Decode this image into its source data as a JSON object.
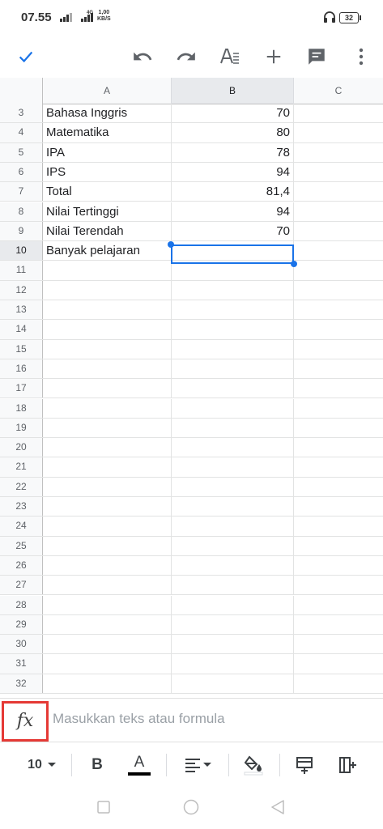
{
  "status_bar": {
    "time": "07.55",
    "network": "4G",
    "speed_value": "1,00",
    "speed_unit": "KB/S",
    "battery": "32"
  },
  "toolbar": {
    "done_icon": "check-icon",
    "undo_icon": "undo-icon",
    "redo_icon": "redo-icon",
    "text_format_icon": "text-format-icon",
    "insert_icon": "plus-icon",
    "comment_icon": "comment-icon",
    "more_icon": "more-vert-icon"
  },
  "grid": {
    "columns": [
      "A",
      "B",
      "C"
    ],
    "rows": [
      {
        "num": "3",
        "a": "Bahasa Inggris",
        "b": "70"
      },
      {
        "num": "4",
        "a": "Matematika",
        "b": "80"
      },
      {
        "num": "5",
        "a": "IPA",
        "b": "78"
      },
      {
        "num": "6",
        "a": "IPS",
        "b": "94"
      },
      {
        "num": "7",
        "a": "Total",
        "b": "81,4"
      },
      {
        "num": "8",
        "a": "Nilai Tertinggi",
        "b": "94"
      },
      {
        "num": "9",
        "a": "Nilai Terendah",
        "b": "70"
      },
      {
        "num": "10",
        "a": "Banyak pelajaran",
        "b": ""
      },
      {
        "num": "11",
        "a": "",
        "b": ""
      },
      {
        "num": "12",
        "a": "",
        "b": ""
      },
      {
        "num": "13",
        "a": "",
        "b": ""
      },
      {
        "num": "14",
        "a": "",
        "b": ""
      },
      {
        "num": "15",
        "a": "",
        "b": ""
      },
      {
        "num": "16",
        "a": "",
        "b": ""
      },
      {
        "num": "17",
        "a": "",
        "b": ""
      },
      {
        "num": "18",
        "a": "",
        "b": ""
      },
      {
        "num": "19",
        "a": "",
        "b": ""
      },
      {
        "num": "20",
        "a": "",
        "b": ""
      },
      {
        "num": "21",
        "a": "",
        "b": ""
      },
      {
        "num": "22",
        "a": "",
        "b": ""
      },
      {
        "num": "23",
        "a": "",
        "b": ""
      },
      {
        "num": "24",
        "a": "",
        "b": ""
      },
      {
        "num": "25",
        "a": "",
        "b": ""
      },
      {
        "num": "26",
        "a": "",
        "b": ""
      },
      {
        "num": "27",
        "a": "",
        "b": ""
      },
      {
        "num": "28",
        "a": "",
        "b": ""
      },
      {
        "num": "29",
        "a": "",
        "b": ""
      },
      {
        "num": "30",
        "a": "",
        "b": ""
      },
      {
        "num": "31",
        "a": "",
        "b": ""
      },
      {
        "num": "32",
        "a": "",
        "b": ""
      }
    ],
    "selected_cell": "B10",
    "selection_color": "#1a73e8"
  },
  "formula_bar": {
    "fx_label": "fx",
    "placeholder": "Masukkan teks atau formula",
    "highlight_color": "#e53935"
  },
  "format_bar": {
    "font_size": "10",
    "bold_label": "B",
    "text_color_label": "A"
  }
}
